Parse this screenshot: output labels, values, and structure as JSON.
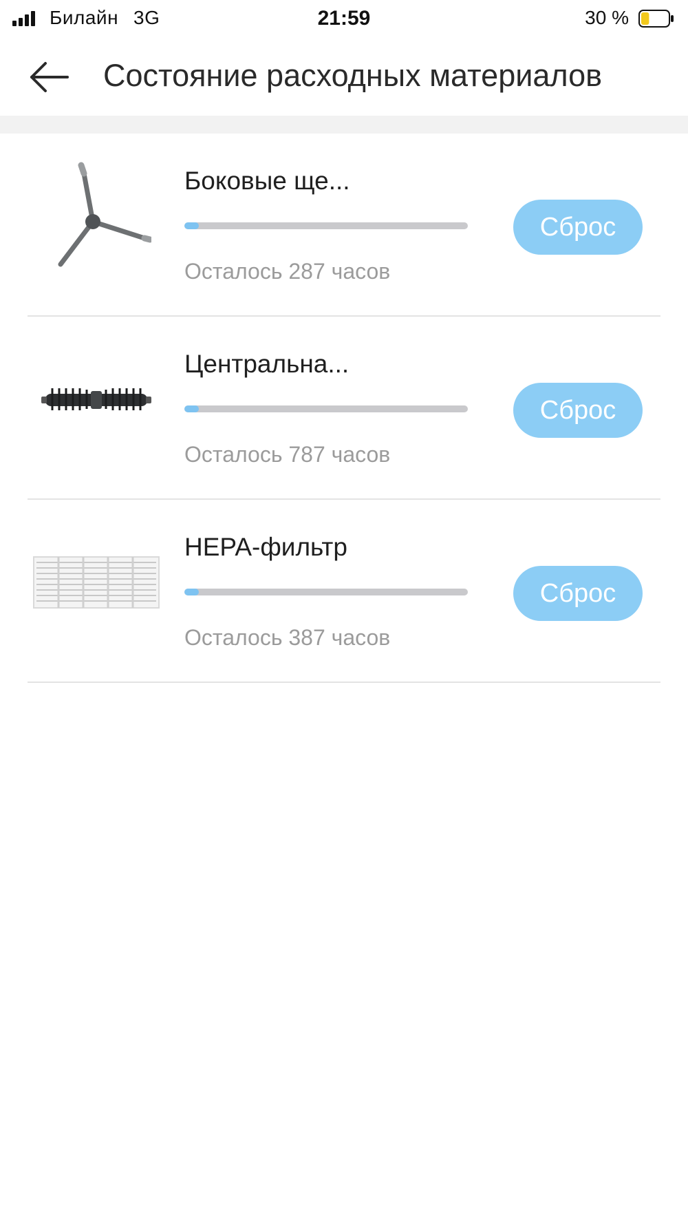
{
  "status_bar": {
    "carrier": "Билайн",
    "network": "3G",
    "time": "21:59",
    "battery_percent": "30 %",
    "battery_level": 0.3,
    "battery_color": "#f2c91d"
  },
  "header": {
    "back_icon": "arrow-left-icon",
    "title": "Состояние расходных материалов"
  },
  "colors": {
    "accent": "#8ccdf5",
    "progress_fill": "#7ec3f1",
    "progress_track": "#c9c9cc",
    "secondary_text": "#9b9b9b"
  },
  "items": [
    {
      "name": "Боковые ще...",
      "remaining": "Осталось 287 часов",
      "progress": 0.05,
      "reset_label": "Сброс",
      "icon": "side-brush-icon"
    },
    {
      "name": "Центральна...",
      "remaining": "Осталось 787 часов",
      "progress": 0.05,
      "reset_label": "Сброс",
      "icon": "main-brush-icon"
    },
    {
      "name": "HEPA-фильтр",
      "remaining": "Осталось 387 часов",
      "progress": 0.05,
      "reset_label": "Сброс",
      "icon": "hepa-filter-icon"
    }
  ]
}
